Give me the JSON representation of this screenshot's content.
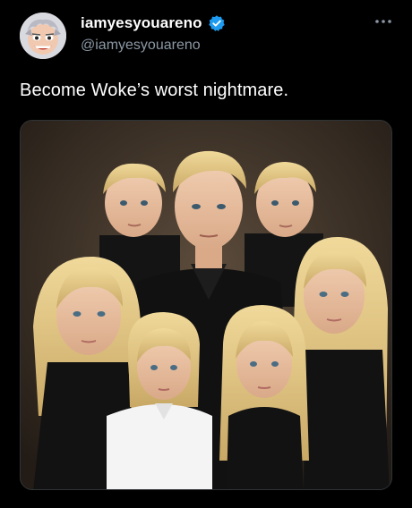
{
  "tweet": {
    "display_name": "iamyesyouareno",
    "handle": "@iamyesyouareno",
    "text": "Become Woke’s worst nightmare.",
    "verified": true,
    "more_icon": "more-horizontal-icon",
    "verified_icon": "verified-badge-icon"
  },
  "colors": {
    "background": "#000000",
    "text_primary": "#ffffff",
    "text_secondary": "#8b98a5",
    "verified_blue": "#1d9bf0"
  }
}
